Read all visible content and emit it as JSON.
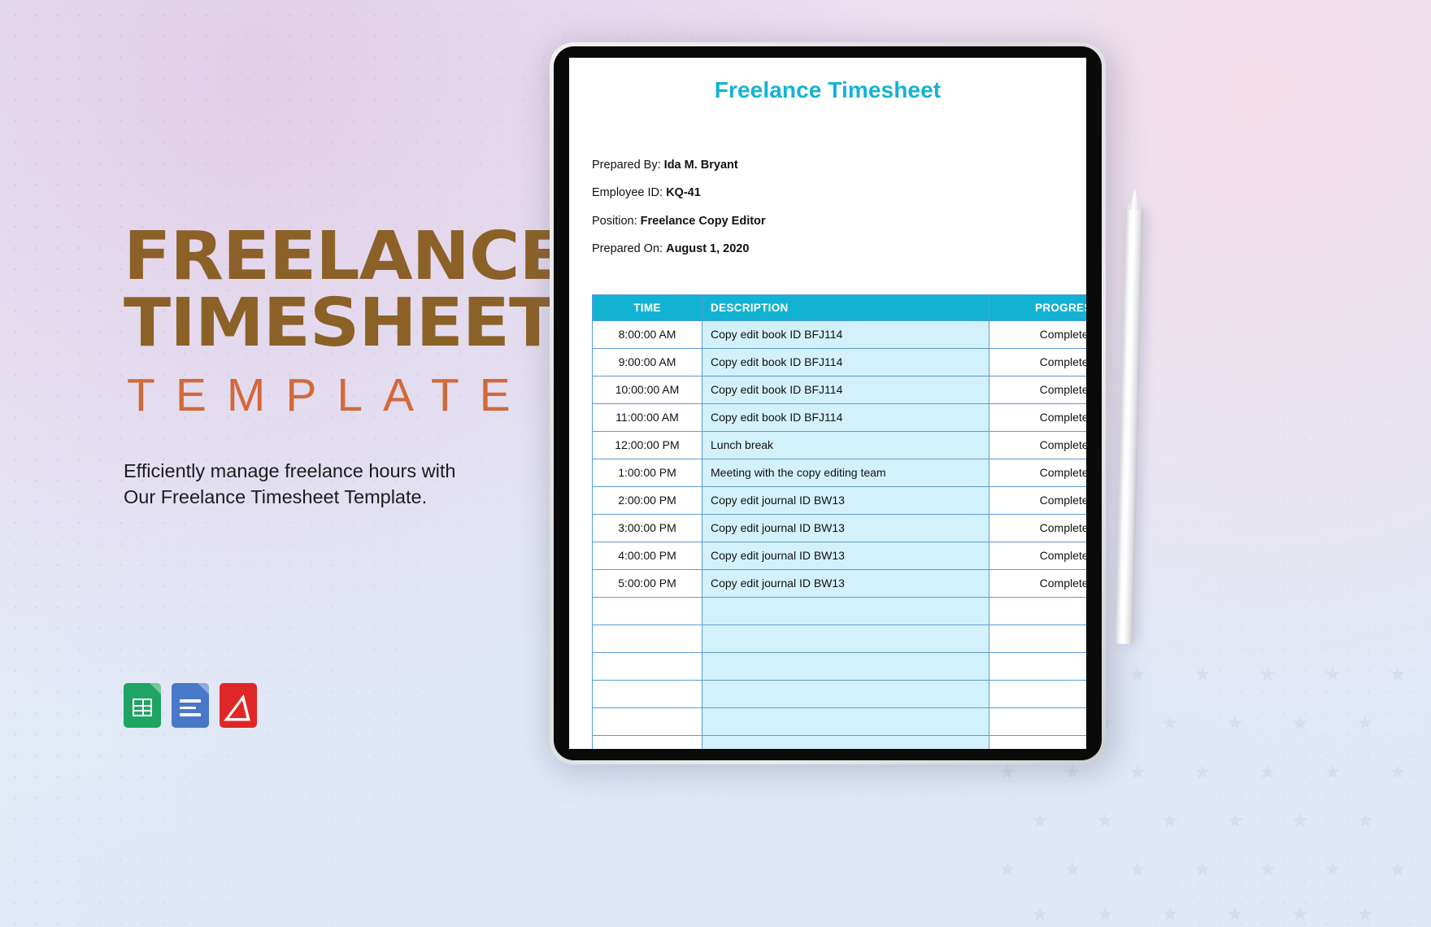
{
  "promo": {
    "title_line1": "FREELANCE",
    "title_line2": "TIMESHEET",
    "title_line3": "TEMPLATE",
    "blurb_line1": "Efficiently manage freelance hours with",
    "blurb_line2": "Our Freelance Timesheet Template.",
    "title_color": "#8b6127",
    "accent_color": "#d2693a"
  },
  "formats": [
    {
      "name": "google-sheets",
      "label": "Google Sheets",
      "color": "#1fa463"
    },
    {
      "name": "google-docs",
      "label": "Google Docs",
      "color": "#4a78c8"
    },
    {
      "name": "pdf",
      "label": "PDF",
      "glyph": "A",
      "color": "#e02727"
    }
  ],
  "document": {
    "title": "Freelance Timesheet",
    "title_color": "#13b3d4",
    "meta": [
      {
        "label": "Prepared By:",
        "value": "Ida M. Bryant"
      },
      {
        "label": "Employee ID:",
        "value": "KQ-41"
      },
      {
        "label": "Position:",
        "value": "Freelance Copy Editor"
      },
      {
        "label": "Prepared On:",
        "value": "August 1, 2020"
      }
    ],
    "table": {
      "header_bg": "#12b2d2",
      "border_color": "#5b9bd5",
      "desc_cell_bg": "#d3f1fa",
      "columns": [
        "TIME",
        "DESCRIPTION",
        "PROGRESS"
      ],
      "rows": [
        {
          "time": "8:00:00 AM",
          "description": "Copy edit book ID BFJ114",
          "progress": "Completed"
        },
        {
          "time": "9:00:00 AM",
          "description": "Copy edit book ID BFJ114",
          "progress": "Completed"
        },
        {
          "time": "10:00:00 AM",
          "description": "Copy edit book ID BFJ114",
          "progress": "Completed"
        },
        {
          "time": "11:00:00 AM",
          "description": "Copy edit book ID BFJ114",
          "progress": "Completed"
        },
        {
          "time": "12:00:00 PM",
          "description": "Lunch break",
          "progress": "Completed"
        },
        {
          "time": "1:00:00 PM",
          "description": "Meeting with the copy editing team",
          "progress": "Completed"
        },
        {
          "time": "2:00:00 PM",
          "description": "Copy edit journal ID BW13",
          "progress": "Completed"
        },
        {
          "time": "3:00:00 PM",
          "description": "Copy edit journal ID BW13",
          "progress": "Completed"
        },
        {
          "time": "4:00:00 PM",
          "description": "Copy edit journal ID BW13",
          "progress": "Completed"
        },
        {
          "time": "5:00:00 PM",
          "description": "Copy edit journal ID BW13",
          "progress": "Completed"
        },
        {
          "time": "",
          "description": "",
          "progress": ""
        },
        {
          "time": "",
          "description": "",
          "progress": ""
        },
        {
          "time": "",
          "description": "",
          "progress": ""
        },
        {
          "time": "",
          "description": "",
          "progress": ""
        },
        {
          "time": "",
          "description": "",
          "progress": ""
        },
        {
          "time": "",
          "description": "",
          "progress": ""
        }
      ]
    }
  }
}
